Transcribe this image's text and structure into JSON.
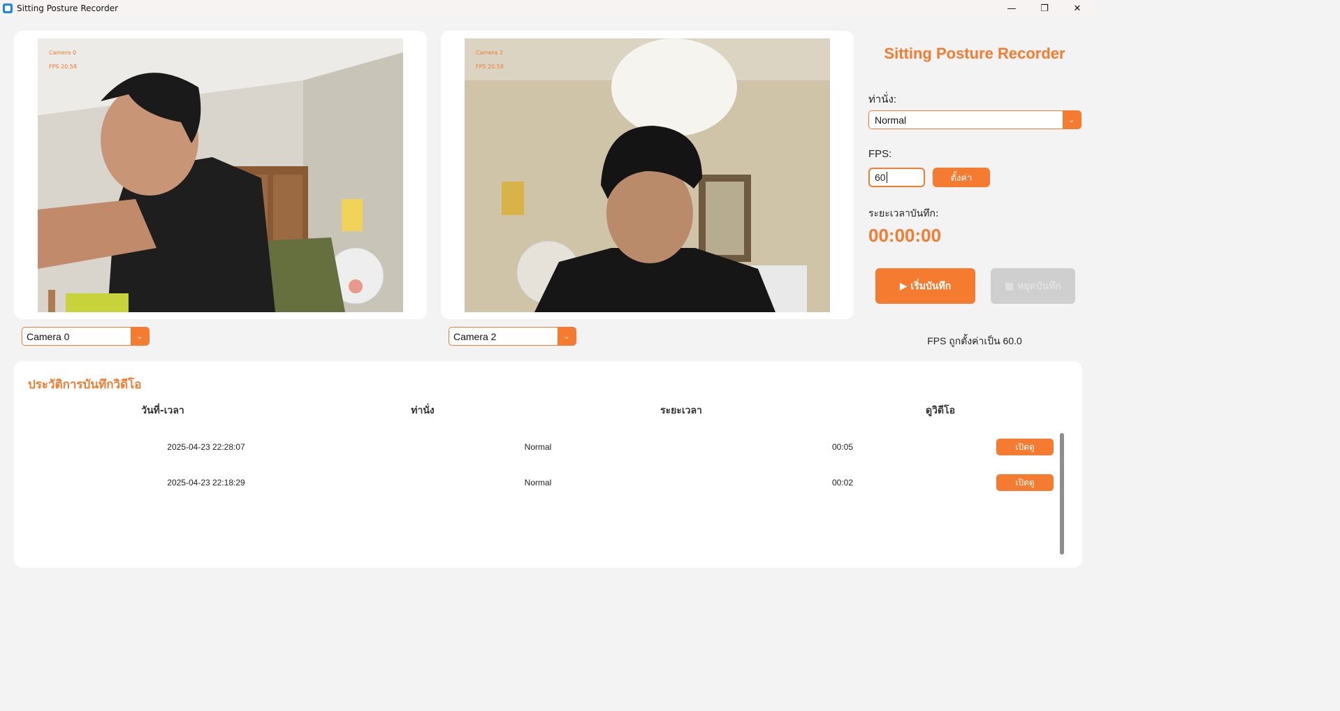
{
  "window": {
    "title": "Sitting Posture Recorder",
    "minimize_glyph": "—",
    "restore_glyph": "❐",
    "close_glyph": "✕"
  },
  "cameras": [
    {
      "overlay_name": "Camera 0",
      "overlay_fps": "FPS 20.58",
      "selected": "Camera 0"
    },
    {
      "overlay_name": "Camera 2",
      "overlay_fps": "FPS 20.58",
      "selected": "Camera 2"
    }
  ],
  "panel": {
    "title": "Sitting Posture Recorder",
    "posture_label": "ท่านั่ง:",
    "posture_value": "Normal",
    "fps_label": "FPS:",
    "fps_value": "60",
    "set_button": "ตั้งค่า",
    "duration_label": "ระยะเวลาบันทึก:",
    "timer": "00:00:00",
    "start_button": "▶ เริ่มบันทึก",
    "stop_button": "■ หยุดบันทึก",
    "status": "FPS ถูกตั้งค่าเป็น 60.0"
  },
  "history": {
    "title": "ประวัติการบันทึกวิดีโอ",
    "columns": [
      "วันที่-เวลา",
      "ท่านั่ง",
      "ระยะเวลา",
      "ดูวิดีโอ"
    ],
    "rows": [
      {
        "datetime": "2025-04-23 22:28:07",
        "posture": "Normal",
        "duration": "00:05",
        "action": "เปิดดู"
      },
      {
        "datetime": "2025-04-23 22:18:29",
        "posture": "Normal",
        "duration": "00:02",
        "action": "เปิดดู"
      }
    ]
  },
  "colors": {
    "accent": "#f47b30",
    "disabled": "#cfcfcf",
    "card": "#ffffff",
    "background": "#f3f3f3"
  },
  "icons": [
    "app-icon",
    "minimize-icon",
    "restore-icon",
    "close-icon",
    "chevron-down-icon",
    "play-icon",
    "stop-icon"
  ]
}
